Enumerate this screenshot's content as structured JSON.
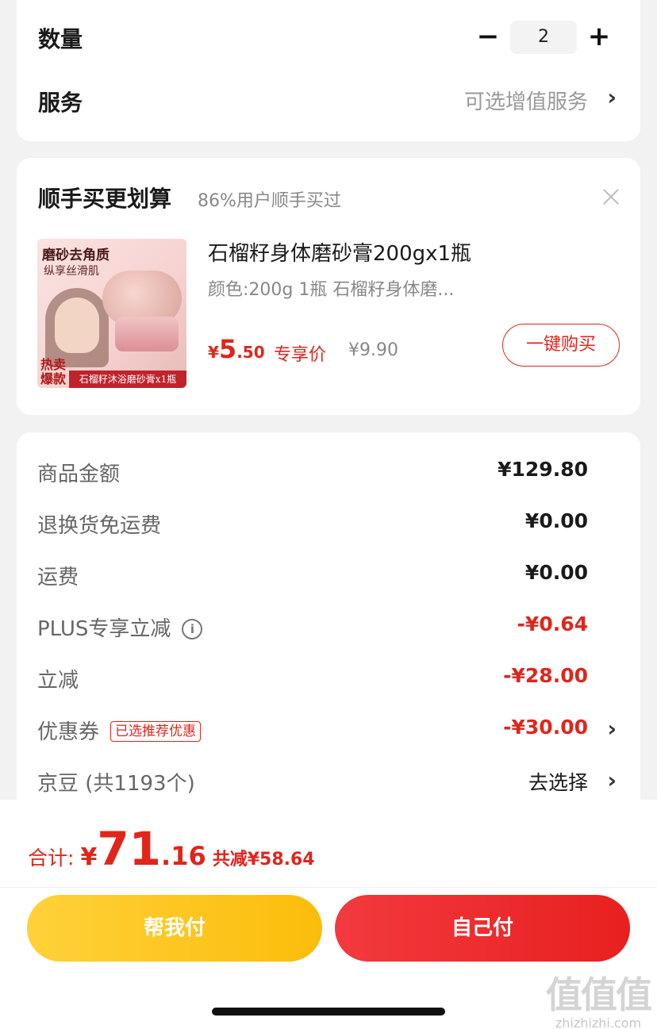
{
  "quantity_card": {
    "qty_label": "数量",
    "qty_minus": "−",
    "qty_value": "2",
    "qty_plus": "+",
    "service_label": "服务",
    "service_value": "可选增值服务",
    "chevron": "›"
  },
  "bundle": {
    "title": "顺手买更划算",
    "subtitle": "86%用户顺手买过",
    "thumb": {
      "title": "磨砂去角质",
      "subtitle": "纵享丝滑肌",
      "hot": "热卖爆款",
      "band": "石榴籽沐浴磨砂膏x1瓶"
    },
    "product_name": "石榴籽身体磨砂膏200gx1瓶",
    "product_spec": "颜色:200g 1瓶 石榴籽身体磨...",
    "price_yen": "¥",
    "price_int": "5",
    "price_dec": ".50",
    "price_tag": "专享价",
    "price_orig": "¥9.90",
    "buy_label": "一键购买"
  },
  "summary": {
    "rows": [
      {
        "label": "商品金额",
        "value": "¥129.80"
      },
      {
        "label": "退换货免运费",
        "value": "¥0.00"
      },
      {
        "label": "运费",
        "value": "¥0.00"
      },
      {
        "label": "PLUS专享立减",
        "value": "-¥0.64",
        "info": "i"
      },
      {
        "label": "立减",
        "value": "-¥28.00"
      },
      {
        "label": "优惠券",
        "value": "-¥30.00",
        "badge": "已选推荐优惠"
      },
      {
        "label": "京豆 (共1193个)",
        "value": "去选择"
      }
    ],
    "chevron": "›"
  },
  "footer": {
    "total_label": "合计:",
    "total_yen": "¥",
    "total_int": "71",
    "total_dec": ".16",
    "total_saved": "共减¥58.64",
    "help_pay": "帮我付",
    "self_pay": "自己付"
  },
  "watermark": {
    "mark": "值值值",
    "site": "zhizhizhi.com"
  },
  "colors": {
    "accent_red": "#e1251b",
    "help_yellow": "#fbbd0a",
    "self_red": "#e8201f"
  }
}
